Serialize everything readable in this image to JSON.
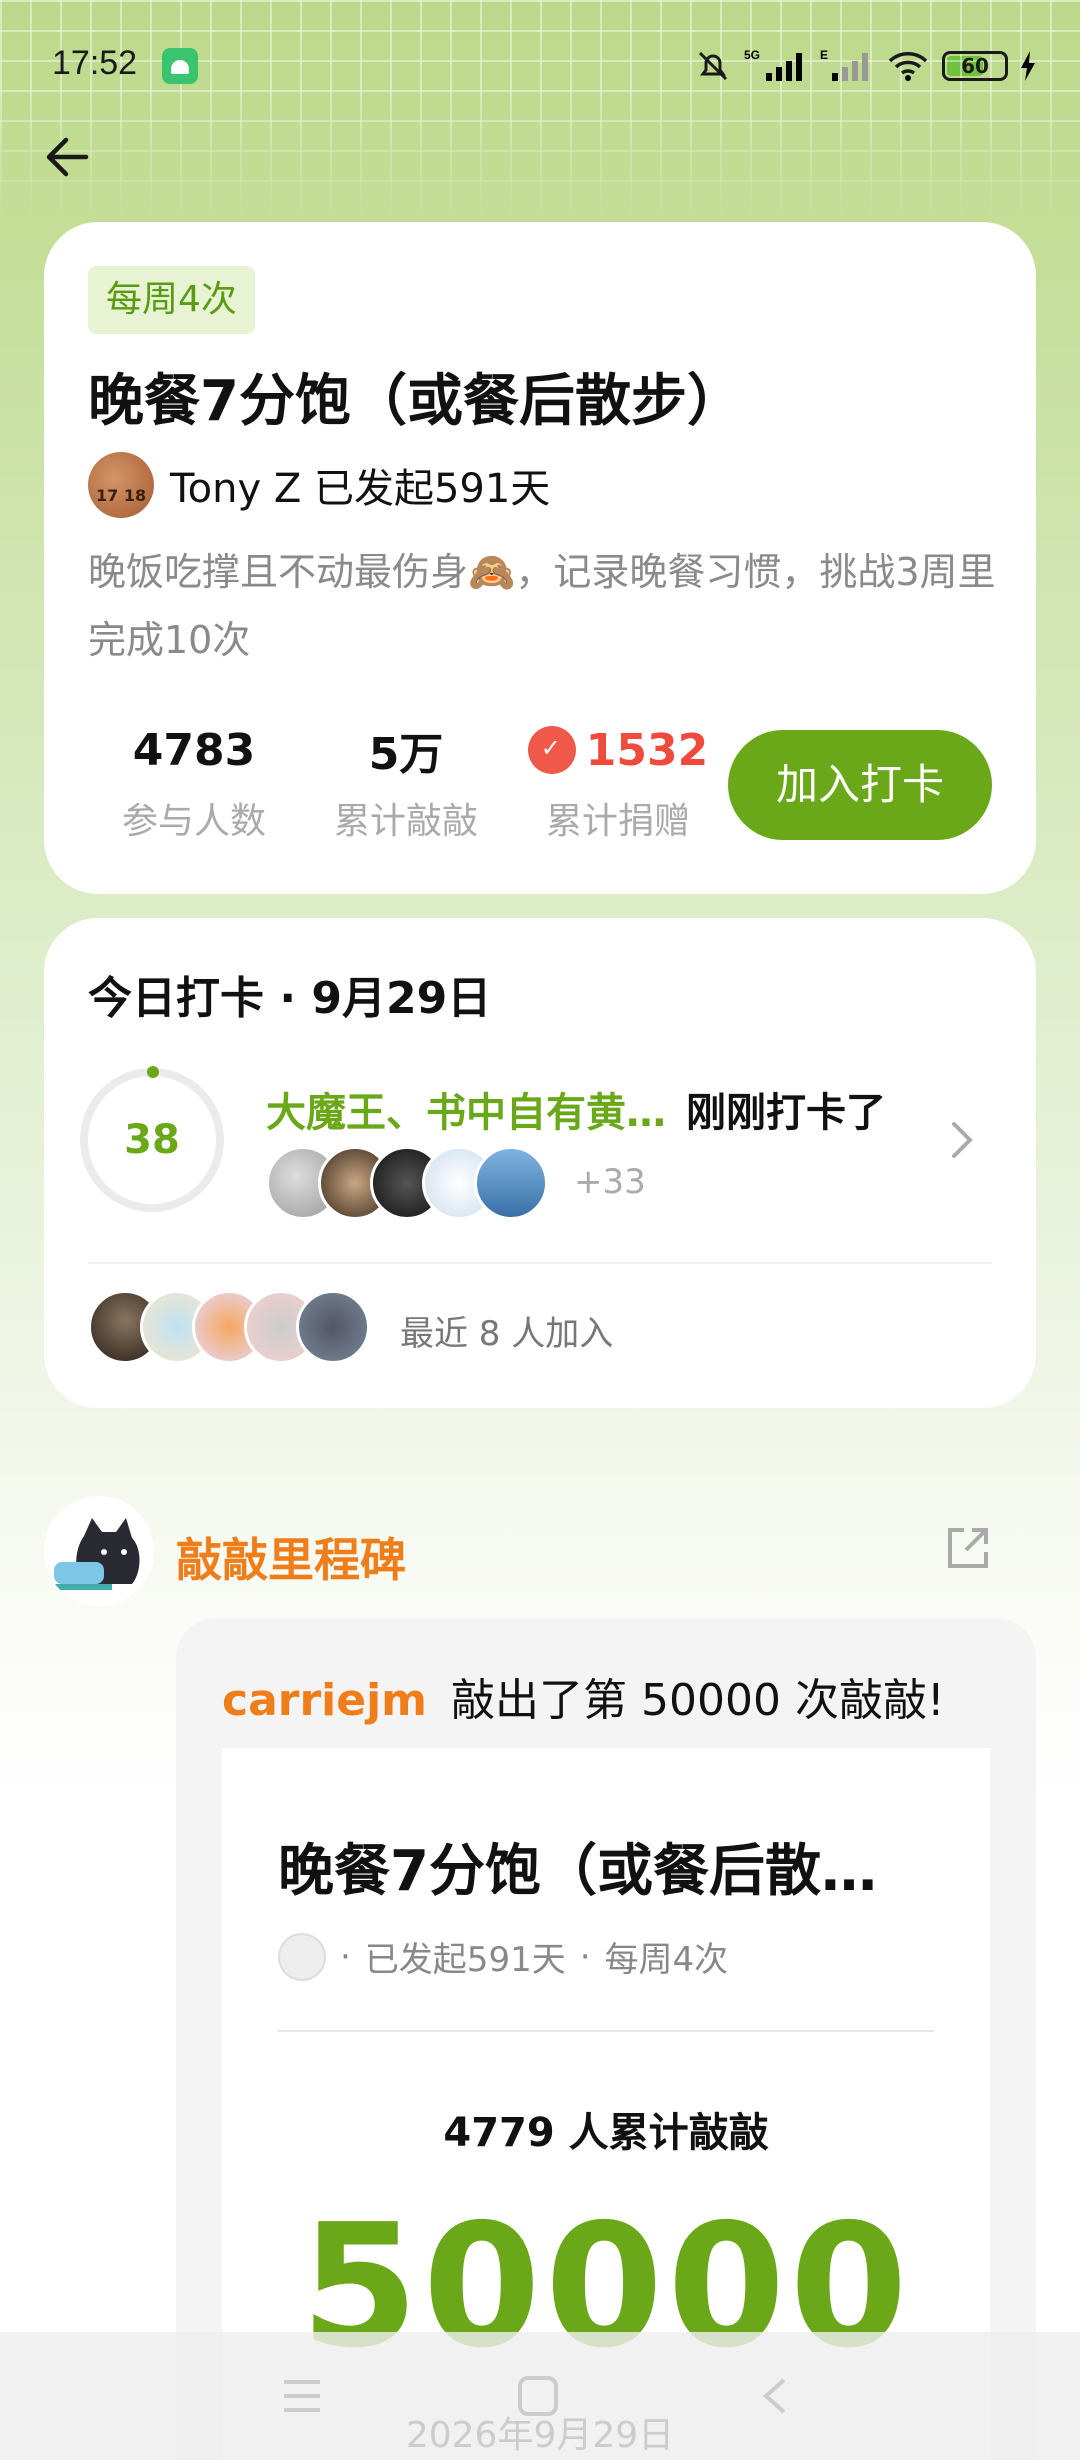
{
  "status_bar": {
    "time": "17:52",
    "battery": "60"
  },
  "challenge": {
    "frequency_tag": "每周4次",
    "title": "晚餐7分饱（或餐后散步）",
    "author_line": "Tony Z 已发起591天",
    "description": "晚饭吃撑且不动最伤身🙈，记录晚餐习惯，挑战3周里完成10次",
    "stats": [
      {
        "value": "4783",
        "label": "参与人数"
      },
      {
        "value": "5万",
        "label": "累计敲敲"
      },
      {
        "value": "1532",
        "label": "累计捐赠"
      }
    ],
    "join_label": "加入打卡"
  },
  "today": {
    "title": "今日打卡 · 9月29日",
    "count": "38",
    "names": "大魔王、书中自有黄…",
    "action": "刚刚打卡了",
    "more": "+33",
    "recent": "最近 8 人加入"
  },
  "milestone": {
    "title": "敲敲里程碑",
    "user": "carriejm",
    "headline": "敲出了第 50000 次敲敲!",
    "card_title": "晚餐7分饱（或餐后散…",
    "meta_days": "已发起591天",
    "meta_freq": "每周4次",
    "people": "4779 人累计敲敲",
    "total": "50000",
    "date": "2026年9月29日"
  },
  "colors": {
    "accent": "#6aa81a",
    "orange": "#ef7d1a",
    "red": "#f04a3d"
  }
}
